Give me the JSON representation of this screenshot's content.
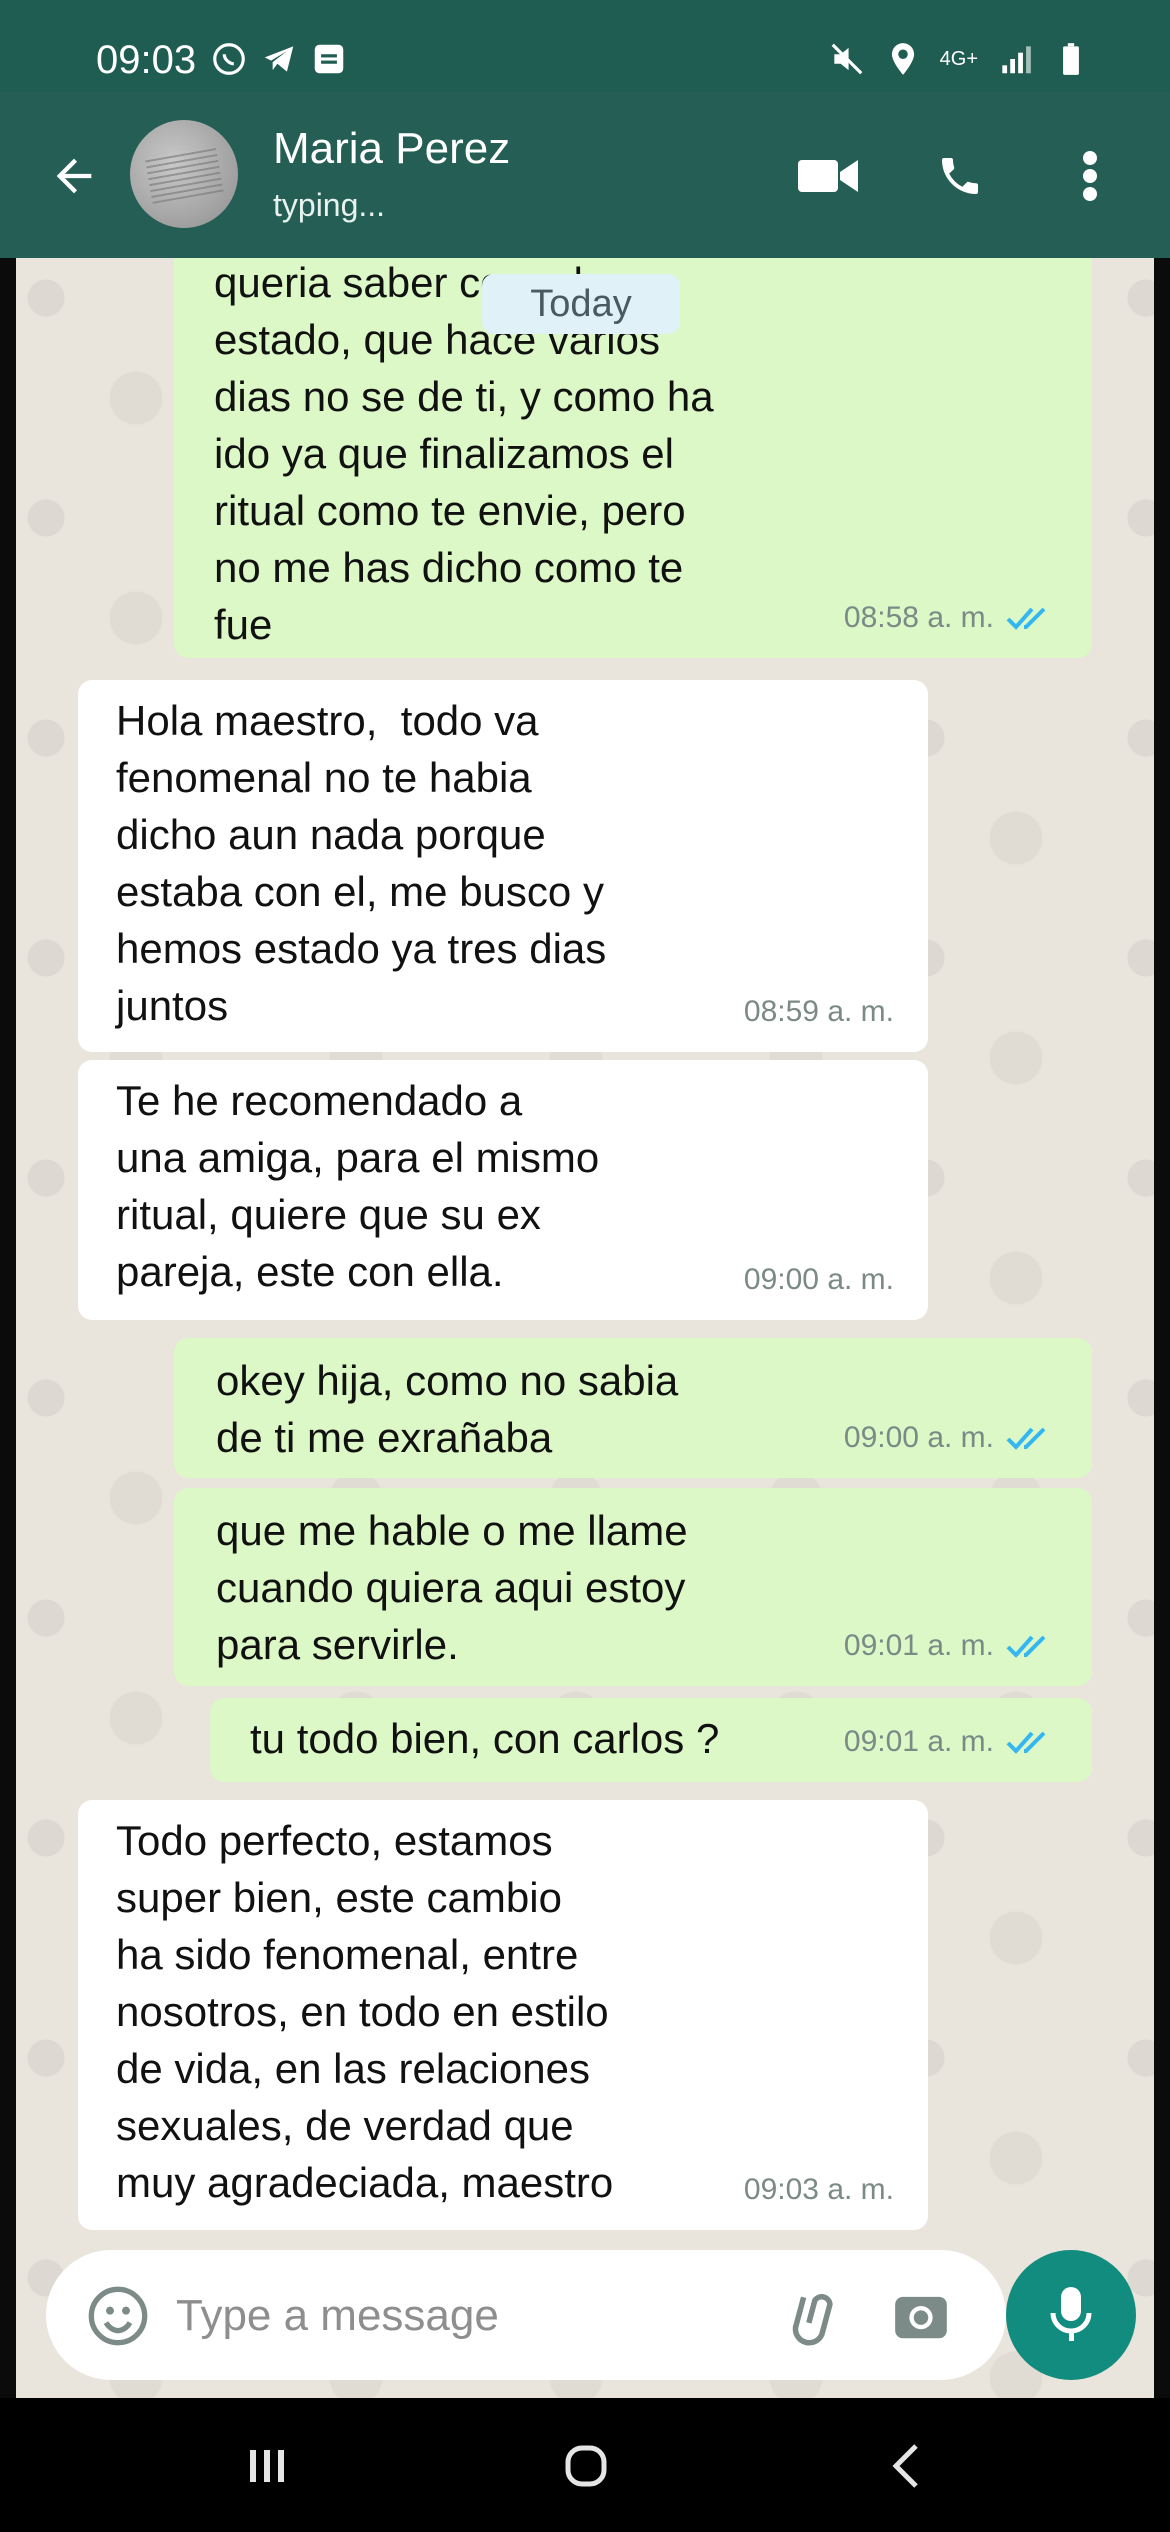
{
  "status_bar": {
    "time": "09:03",
    "network": "4G+"
  },
  "header": {
    "contact_name": "Maria Perez",
    "contact_status": "typing..."
  },
  "date_separator": "Today",
  "messages": [
    {
      "direction": "out",
      "text": "queria saber como has\nestado, que hace varios\ndias no se de ti, y como ha\nido ya que finalizamos el\nritual como te envie, pero\nno me has dicho como te\nfue",
      "time": "08:58 a. m.",
      "read": true
    },
    {
      "direction": "in",
      "text": "Hola maestro,  todo va\nfenomenal no te habia\ndicho aun nada porque\nestaba con el, me busco y\nhemos estado ya tres dias\njuntos",
      "time": "08:59 a. m."
    },
    {
      "direction": "in",
      "text": "Te he recomendado a\nuna amiga, para el mismo\nritual, quiere que su ex\npareja, este con ella.",
      "time": "09:00 a. m."
    },
    {
      "direction": "out",
      "text": "okey hija, como no sabia\nde ti me exrañaba",
      "time": "09:00 a. m.",
      "read": true
    },
    {
      "direction": "out",
      "text": "que me hable o me llame\ncuando quiera aqui estoy\npara servirle.",
      "time": "09:01 a. m.",
      "read": true
    },
    {
      "direction": "out",
      "text": "tu todo bien, con carlos ?",
      "time": "09:01 a. m.",
      "read": true
    },
    {
      "direction": "in",
      "text": "Todo perfecto, estamos\nsuper bien, este cambio\nha sido fenomenal, entre\nnosotros, en todo en estilo\nde vida, en las relaciones\nsexuales, de verdad que\nmuy agradeciada, maestro",
      "time": "09:03 a. m."
    }
  ],
  "composer": {
    "placeholder": "Type a message"
  },
  "colors": {
    "header": "#245e54",
    "outgoing": "#dcf8c6",
    "incoming": "#ffffff",
    "read_ticks": "#34b7f1",
    "mic": "#128c7e"
  },
  "icons": [
    "whatsapp-icon",
    "telegram-icon",
    "jobtoday-icon",
    "mute-icon",
    "location-icon",
    "signal-icon",
    "battery-icon",
    "back-arrow-icon",
    "video-call-icon",
    "phone-icon",
    "more-vert-icon",
    "emoji-icon",
    "attach-icon",
    "camera-icon",
    "mic-icon",
    "recents-icon",
    "home-icon",
    "back-nav-icon"
  ]
}
